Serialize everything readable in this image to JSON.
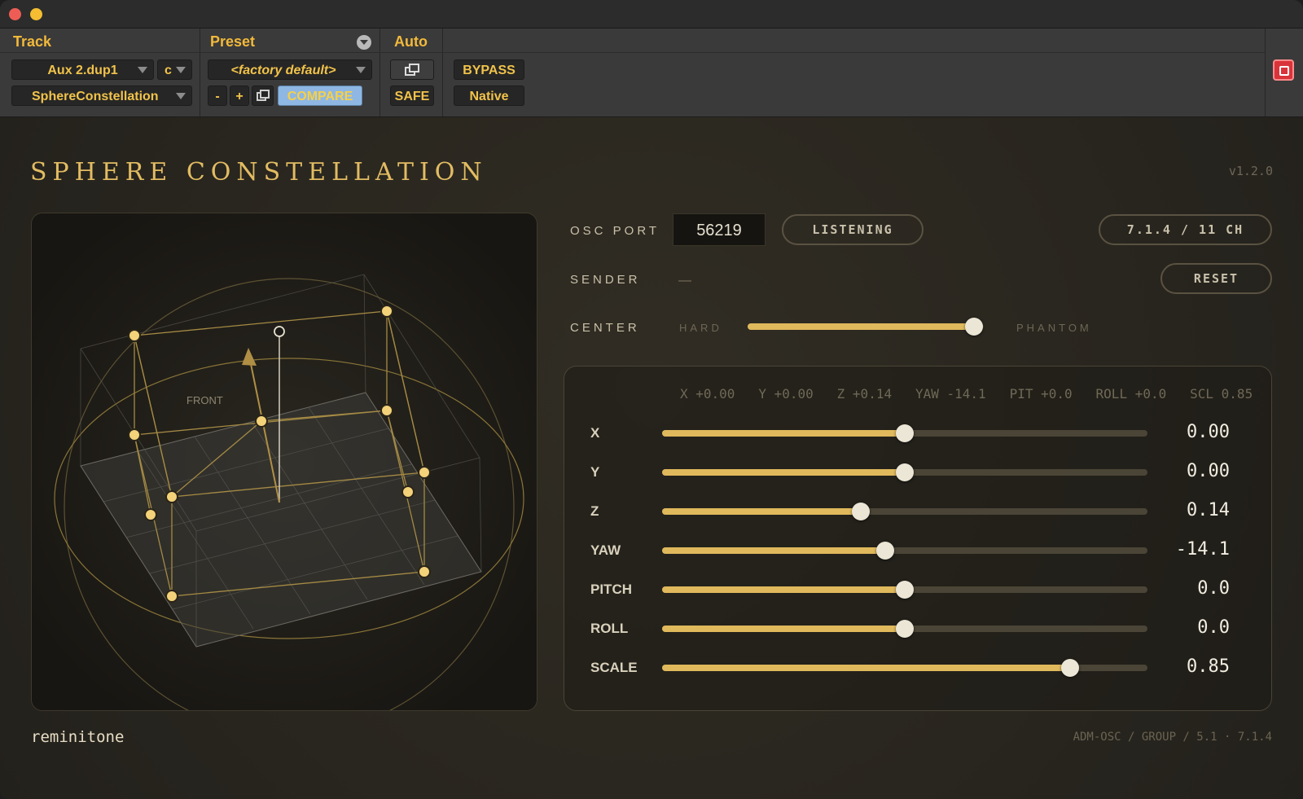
{
  "host": {
    "track_label": "Track",
    "preset_label": "Preset",
    "auto_label": "Auto",
    "track_name": "Aux 2.dup1",
    "channel": "c",
    "plugin_name": "SphereConstellation",
    "preset_name": "<factory default>",
    "minus": "-",
    "plus": "+",
    "compare": "COMPARE",
    "bypass": "BYPASS",
    "safe": "SAFE",
    "native": "Native"
  },
  "plugin": {
    "title": "SPHERE CONSTELLATION",
    "version": "v1.2.0",
    "front_label": "FRONT",
    "osc_port_label": "OSC PORT",
    "osc_port_value": "56219",
    "listening": "LISTENING",
    "format": "7.1.4 / 11 CH",
    "sender_label": "SENDER",
    "sender_value": "—",
    "reset": "RESET",
    "center_label": "CENTER",
    "center_left": "HARD",
    "center_right": "PHANTOM",
    "center_value": 0.96,
    "readout": "X +0.00   Y +0.00   Z +0.14   YAW -14.1   PIT +0.0   ROLL +0.0   SCL 0.85",
    "brand": "reminitone",
    "footer": "ADM-OSC / GROUP / 5.1 · 7.1.4"
  },
  "params": [
    {
      "label": "X",
      "value": "0.00",
      "fraction": 0.5
    },
    {
      "label": "Y",
      "value": "0.00",
      "fraction": 0.5
    },
    {
      "label": "Z",
      "value": "0.14",
      "fraction": 0.41
    },
    {
      "label": "YAW",
      "value": "-14.1",
      "fraction": 0.46
    },
    {
      "label": "PITCH",
      "value": "0.0",
      "fraction": 0.5
    },
    {
      "label": "ROLL",
      "value": "0.0",
      "fraction": 0.5
    },
    {
      "label": "SCALE",
      "value": "0.85",
      "fraction": 0.84
    }
  ],
  "colors": {
    "accent": "#e0b95c",
    "host_text": "#f1c34a",
    "compare_bg": "#8fb7e3",
    "bypass_text": "#f6d048"
  }
}
